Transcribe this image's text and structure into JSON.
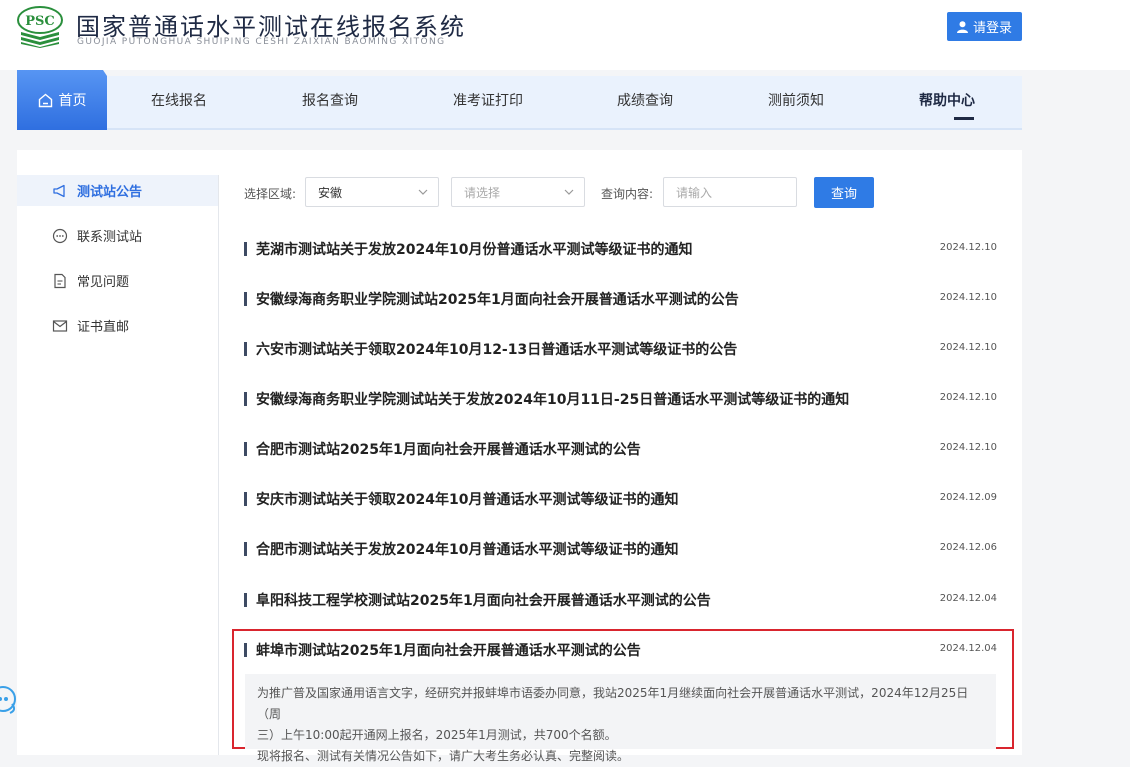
{
  "header": {
    "logo_text": "PSC",
    "title": "国家普通话水平测试在线报名系统",
    "subtitle": "GUOJIA PUTONGHUA SHUIPING CESHI ZAIXIAN BAOMING XITONG",
    "login_label": "请登录"
  },
  "nav": {
    "home": "首页",
    "items": [
      "在线报名",
      "报名查询",
      "准考证打印",
      "成绩查询",
      "测前须知",
      "帮助中心"
    ],
    "active": "帮助中心"
  },
  "sidebar": {
    "items": [
      {
        "label": "测试站公告",
        "icon": "megaphone-icon",
        "active": true
      },
      {
        "label": "联系测试站",
        "icon": "chat-bubble-icon"
      },
      {
        "label": "常见问题",
        "icon": "document-icon"
      },
      {
        "label": "证书直邮",
        "icon": "mail-icon"
      }
    ]
  },
  "filters": {
    "region_label": "选择区域:",
    "region_value": "安徽",
    "sub_placeholder": "请选择",
    "query_label": "查询内容:",
    "query_placeholder": "请输入",
    "query_button": "查询"
  },
  "notices": [
    {
      "title": "芜湖市测试站关于发放2024年10月份普通话水平测试等级证书的通知",
      "date": "2024.12.10"
    },
    {
      "title": "安徽绿海商务职业学院测试站2025年1月面向社会开展普通话水平测试的公告",
      "date": "2024.12.10"
    },
    {
      "title": "六安市测试站关于领取2024年10月12-13日普通话水平测试等级证书的公告",
      "date": "2024.12.10"
    },
    {
      "title": "安徽绿海商务职业学院测试站关于发放2024年10月11日-25日普通话水平测试等级证书的通知",
      "date": "2024.12.10"
    },
    {
      "title": "合肥市测试站2025年1月面向社会开展普通话水平测试的公告",
      "date": "2024.12.10"
    },
    {
      "title": "安庆市测试站关于领取2024年10月普通话水平测试等级证书的通知",
      "date": "2024.12.09"
    },
    {
      "title": "合肥市测试站关于发放2024年10月普通话水平测试等级证书的通知",
      "date": "2024.12.06"
    },
    {
      "title": "阜阳科技工程学校测试站2025年1月面向社会开展普通话水平测试的公告",
      "date": "2024.12.04"
    },
    {
      "title": "蚌埠市测试站2025年1月面向社会开展普通话水平测试的公告",
      "date": "2024.12.04"
    }
  ],
  "excerpt": {
    "line1": "为推广普及国家通用语言文字，经研究并报蚌埠市语委办同意，我站2025年1月继续面向社会开展普通话水平测试，2024年12月25日（周",
    "line2": "三）上午10:00起开通网上报名，2025年1月测试，共700个名额。",
    "line3": "现将报名、测试有关情况公告如下，请广大考生务必认真、完整阅读。"
  },
  "colors": {
    "primary": "#2f7be5",
    "highlight_border": "#d9252e",
    "nav_bg": "#eaf2fd"
  }
}
